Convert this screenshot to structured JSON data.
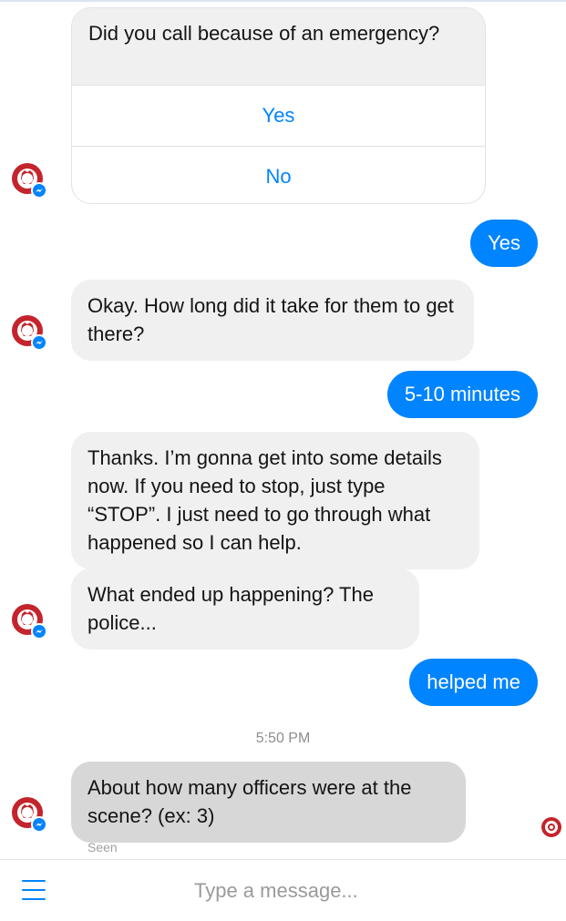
{
  "conversation": {
    "card": {
      "question": "Did you call because of an emergency?",
      "options": [
        "Yes",
        "No"
      ]
    },
    "messages": [
      {
        "sender": "user",
        "text": "Yes"
      },
      {
        "sender": "bot",
        "text": "Okay. How long did it take for them to get there?"
      },
      {
        "sender": "user",
        "text": "5-10 minutes"
      },
      {
        "sender": "bot",
        "text": "Thanks. I’m gonna get into some details now. If you need to stop, just type “STOP”. I just need to go through what happened so I can help."
      },
      {
        "sender": "bot",
        "text": "What ended up happening? The police..."
      },
      {
        "sender": "user",
        "text": "helped me"
      },
      {
        "sender": "bot",
        "text": "About how many officers were at the scene? (ex: 3)"
      }
    ],
    "timestamp": "5:50 PM",
    "read_receipt": "Seen"
  },
  "composer": {
    "placeholder": "Type a message...",
    "menu_icon": "hamburger-menu-icon"
  },
  "colors": {
    "brand_red": "#c4242b",
    "messenger_blue": "#0084ff",
    "incoming_bubble": "#f1f0f0"
  }
}
